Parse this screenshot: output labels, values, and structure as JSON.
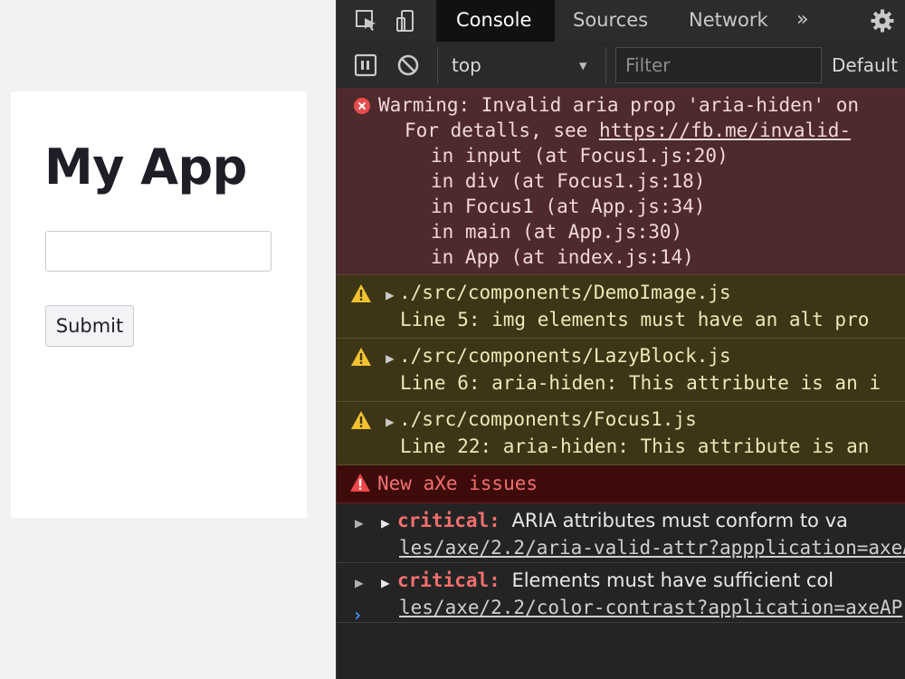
{
  "app": {
    "title": "My App",
    "input_value": "",
    "submit_label": "Submit"
  },
  "devtools": {
    "tabs": [
      {
        "label": "Console",
        "active": true
      },
      {
        "label": "Sources",
        "active": false
      },
      {
        "label": "Network",
        "active": false
      }
    ],
    "more_tabs": "»",
    "toolbar": {
      "context": "top",
      "filter_placeholder": "Filter",
      "levels": "Default"
    },
    "error": {
      "line1": "Warming: Invalid aria prop 'aria-hiden' on",
      "line2_prefix": "For detalls, see ",
      "line2_link": "https://fb.me/invalid-",
      "stack": [
        "in input (at Focus1.js:20)",
        "in div (at Focus1.js:18)",
        "in Focus1 (at App.js:34)",
        "in main (at App.js:30)",
        "in App (at index.js:14)"
      ]
    },
    "warnings": [
      {
        "source": "./src/components/DemoImage.js",
        "detail": "Line 5: img elements must have an alt pro"
      },
      {
        "source": "./src/components/LazyBlock.js",
        "detail": "Line 6: aria-hiden: This attribute is an i"
      },
      {
        "source": "./src/components/Focus1.js",
        "detail": "Line 22: aria-hiden: This attribute is an"
      }
    ],
    "axe_header": "New aXe issues",
    "axe_issues": [
      {
        "severity": "critical:",
        "description": "ARIA attributes must conform to va",
        "url": "les/axe/2.2/aria-valid-attr?appplication=axeA"
      },
      {
        "severity": "critical:",
        "description": "Elements must have sufficient col",
        "url": "les/axe/2.2/color-contrast?application=axeAP"
      }
    ],
    "prompt": "›"
  },
  "colors": {
    "error_bg": "#4e2a2c",
    "warning_bg": "#3c3617",
    "axe_header_bg": "#3e0b0b",
    "critical": "#f26f6f",
    "prompt": "#3f8ff0"
  }
}
